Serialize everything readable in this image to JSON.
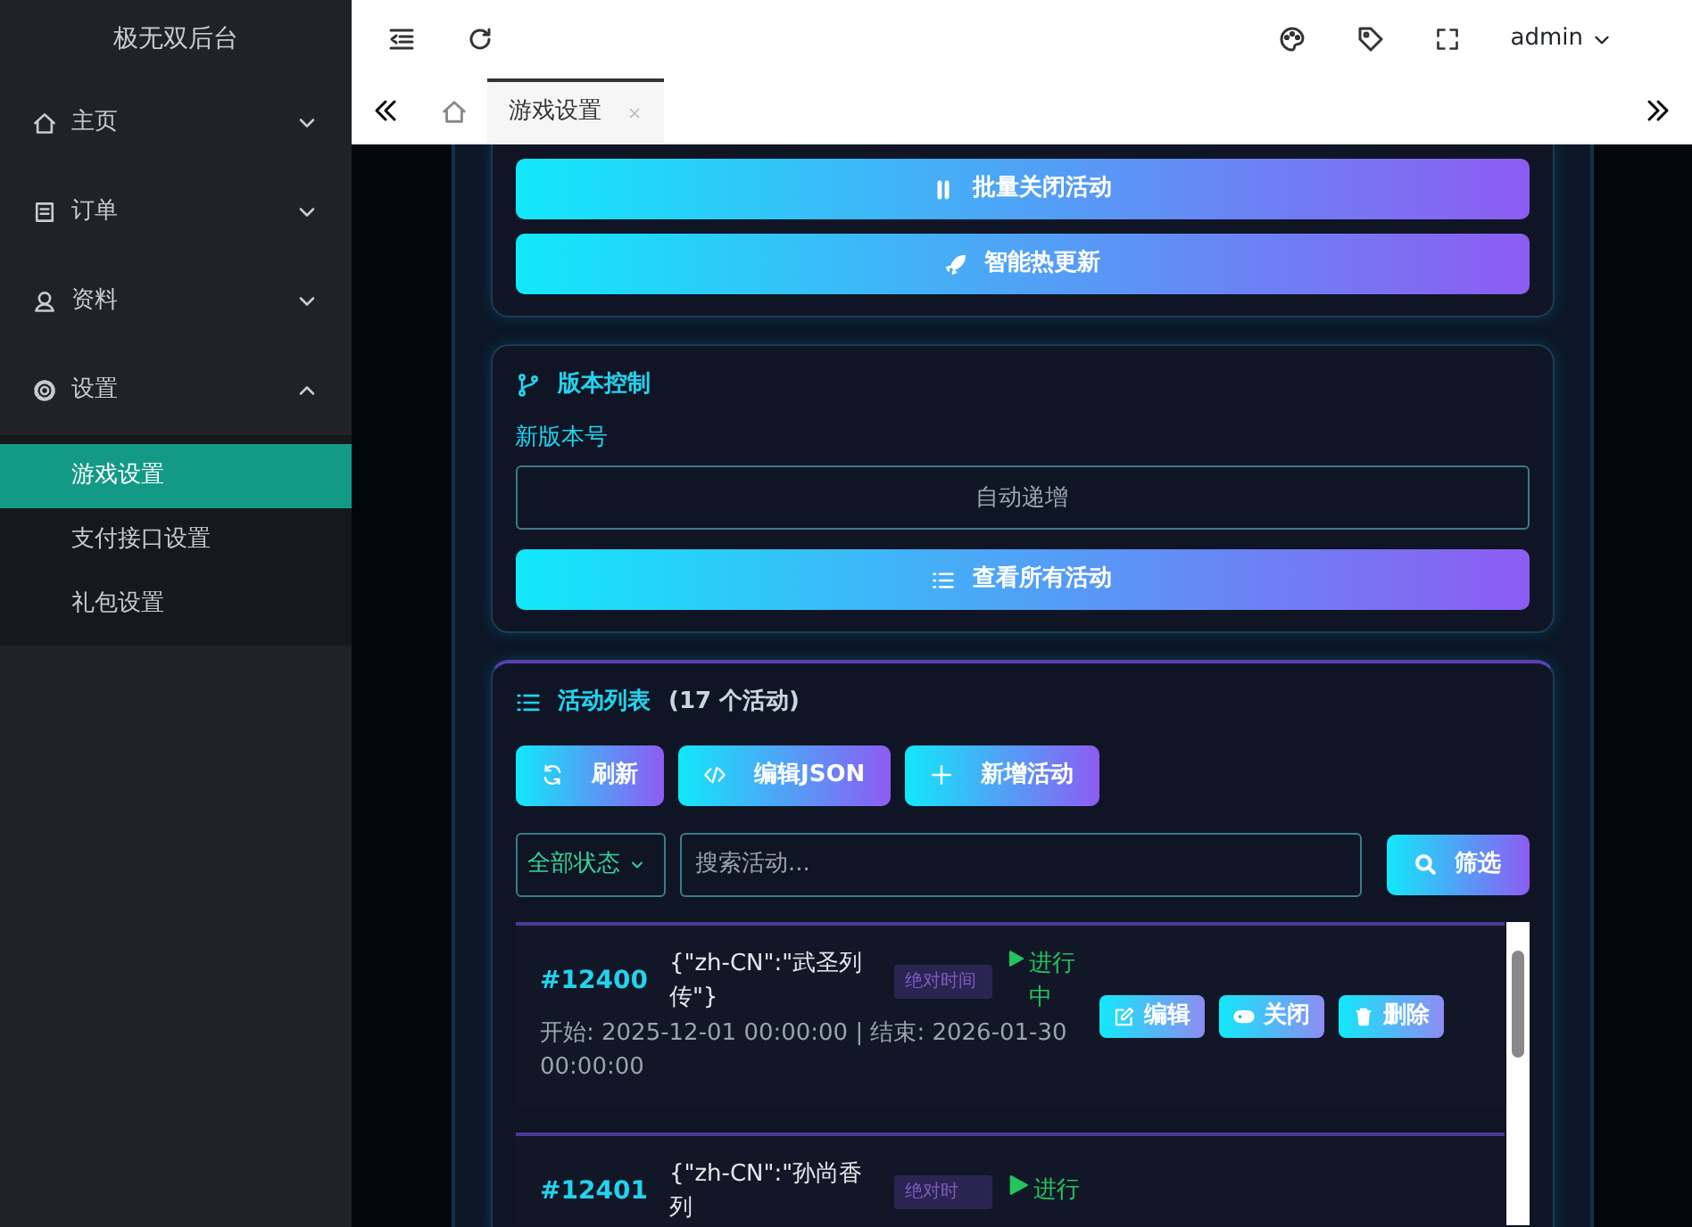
{
  "sidebar": {
    "title": "极无双后台",
    "items": [
      {
        "label": "主页",
        "expanded": false
      },
      {
        "label": "订单",
        "expanded": false
      },
      {
        "label": "资料",
        "expanded": false
      },
      {
        "label": "设置",
        "expanded": true,
        "children": [
          {
            "label": "游戏设置",
            "selected": true
          },
          {
            "label": "支付接口设置",
            "selected": false
          },
          {
            "label": "礼包设置",
            "selected": false
          }
        ]
      }
    ]
  },
  "header": {
    "user": "admin"
  },
  "tabs": [
    {
      "label": "游戏设置",
      "selected": true
    }
  ],
  "quick_actions": {
    "buttons": [
      "批量关闭活动",
      "智能热更新"
    ]
  },
  "version_control": {
    "title": "版本控制",
    "field_label": "新版本号",
    "placeholder": "自动递增",
    "button": "查看所有活动"
  },
  "activity_list": {
    "title": "活动列表",
    "count": "(17 个活动)",
    "toolbar": [
      "刷新",
      "编辑JSON",
      "新增活动"
    ],
    "status_filter": "全部状态",
    "search_placeholder": "搜索活动...",
    "filter_button": "筛选",
    "rows": [
      {
        "id": "#12400",
        "title": "{\"zh-CN\":\"武圣列传\"}",
        "badge": "绝对时间",
        "status": "进行中",
        "time": "开始: 2025-12-01 00:00:00 | 结束: 2026-01-30 00:00:00",
        "actions": [
          "编辑",
          "关闭",
          "删除"
        ]
      },
      {
        "id": "#12401",
        "title": "{\"zh-CN\":\"孙尚香列",
        "badge": "绝对时",
        "status": "进行"
      }
    ]
  }
}
